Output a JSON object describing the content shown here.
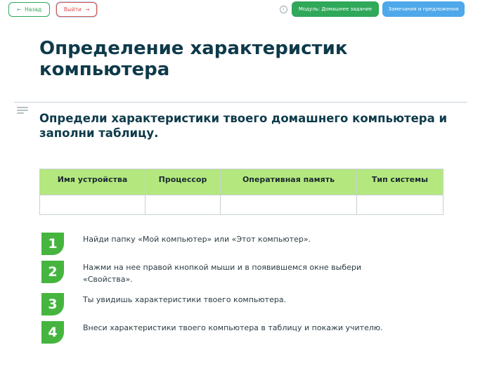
{
  "topbar": {
    "back_label": "Назад",
    "exit_label": "Выйти",
    "module_label": "Модуль: Домашнее задание",
    "feedback_label": "Замечания и предложения",
    "info_glyph": "i"
  },
  "page": {
    "title": "Определение характеристик компьютера",
    "task_heading": "Определи характеристики твоего домашнего компьютера и заполни таблицу."
  },
  "table": {
    "headers": [
      "Имя устройства",
      "Процессор",
      "Оперативная память",
      "Тип системы"
    ],
    "rows": [
      [
        "",
        "",
        "",
        ""
      ]
    ]
  },
  "steps": [
    {
      "num": "1",
      "text": "Найди папку «Мой компьютер» или «Этот компьютер»."
    },
    {
      "num": "2",
      "text": "Нажми на нее правой кнопкой мыши и в появившемся окне выбери «Свойства»."
    },
    {
      "num": "3",
      "text": "Ты увидишь характеристики твоего компьютера."
    },
    {
      "num": "4",
      "text": "Внеси характеристики твоего компьютера в таблицу и покажи учителю."
    }
  ],
  "colors": {
    "accent_green": "#2fa85a",
    "exit_red": "#d9534f",
    "feedback_blue": "#4ea8ea",
    "table_header_green": "#b4e87e",
    "step_green": "#46b53f",
    "title_color": "#0e3a4a"
  }
}
